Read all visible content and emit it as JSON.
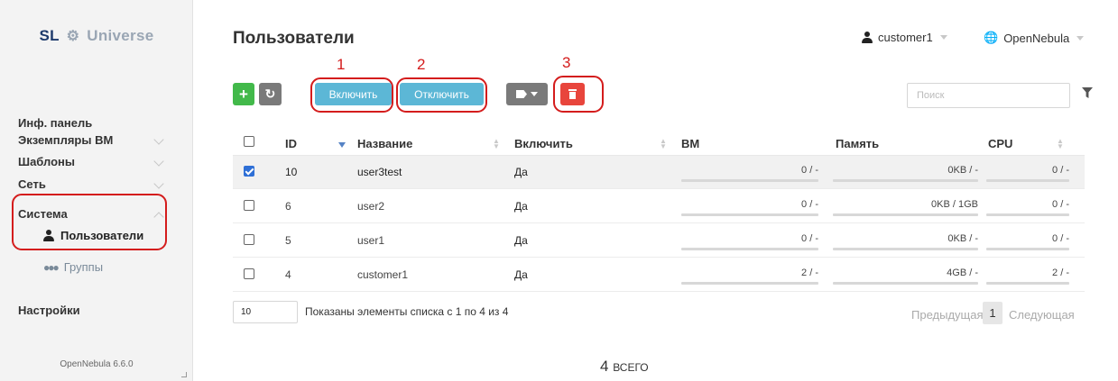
{
  "sidebar": {
    "logo": {
      "sl": "SL",
      "swirl": "⚙",
      "universe": "Universe"
    },
    "items": [
      {
        "label": "Инф. панель"
      },
      {
        "label": "Экземпляры ВМ"
      },
      {
        "label": "Шаблоны"
      },
      {
        "label": "Сеть"
      },
      {
        "label": "Система"
      },
      {
        "label": "Настройки"
      }
    ],
    "sub_items": [
      {
        "label": "Пользователи",
        "icon": "user-icon"
      },
      {
        "label": "Группы",
        "icon": "users-icon"
      }
    ],
    "version": "OpenNebula 6.6.0"
  },
  "header": {
    "title": "Пользователи",
    "user": "customer1",
    "zone": "OpenNebula"
  },
  "annotations": [
    "1",
    "2",
    "3"
  ],
  "toolbar": {
    "add_label": "+",
    "refresh_label": "↻",
    "enable_label": "Включить",
    "disable_label": "Отключить",
    "search_placeholder": "Поиск"
  },
  "table": {
    "columns": [
      "ID",
      "Название",
      "Включить",
      "ВМ",
      "Память",
      "CPU"
    ],
    "rows": [
      {
        "id": "10",
        "name": "user3test",
        "enabled": "Да",
        "vm": "0 / -",
        "memory": "0KB / -",
        "cpu": "0 / -",
        "selected": true
      },
      {
        "id": "6",
        "name": "user2",
        "enabled": "Да",
        "vm": "0 / -",
        "memory": "0KB / 1GB",
        "cpu": "0 / -",
        "selected": false
      },
      {
        "id": "5",
        "name": "user1",
        "enabled": "Да",
        "vm": "0 / -",
        "memory": "0KB / -",
        "cpu": "0 / -",
        "selected": false
      },
      {
        "id": "4",
        "name": "customer1",
        "enabled": "Да",
        "vm": "2 / -",
        "memory": "4GB / -",
        "cpu": "2 / -",
        "selected": false
      }
    ]
  },
  "footer": {
    "page_size": "10",
    "showing": "Показаны элементы списка с 1 по 4 из 4",
    "prev": "Предыдущая",
    "current_page": "1",
    "next": "Следующая",
    "total_count": "4",
    "total_label": "ВСЕГО"
  },
  "colors": {
    "accent_enable": "#5cb7d6",
    "add": "#42b94a",
    "delete": "#e8453c",
    "annotation": "#d41c1c",
    "checkbox_checked": "#2e6fd6"
  }
}
